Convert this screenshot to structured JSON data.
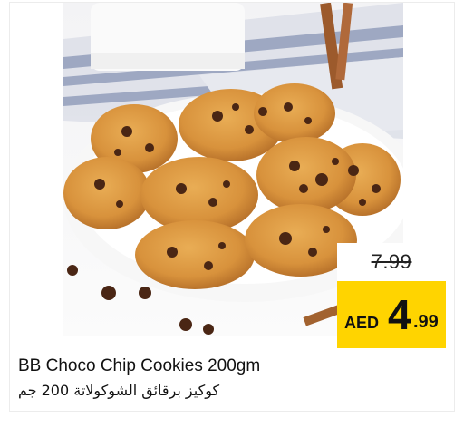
{
  "product": {
    "name_en": "BB Choco Chip Cookies 200gm",
    "name_ar": "كوكيز برقائق الشوكولاتة 200 جم",
    "image_alt": "chocolate-chip-cookies-photo"
  },
  "price": {
    "old": "7.99",
    "currency": "AED",
    "new_int": "4",
    "new_dec": ".99"
  },
  "colors": {
    "price_badge": "#ffd400",
    "background": "#ffffff"
  }
}
